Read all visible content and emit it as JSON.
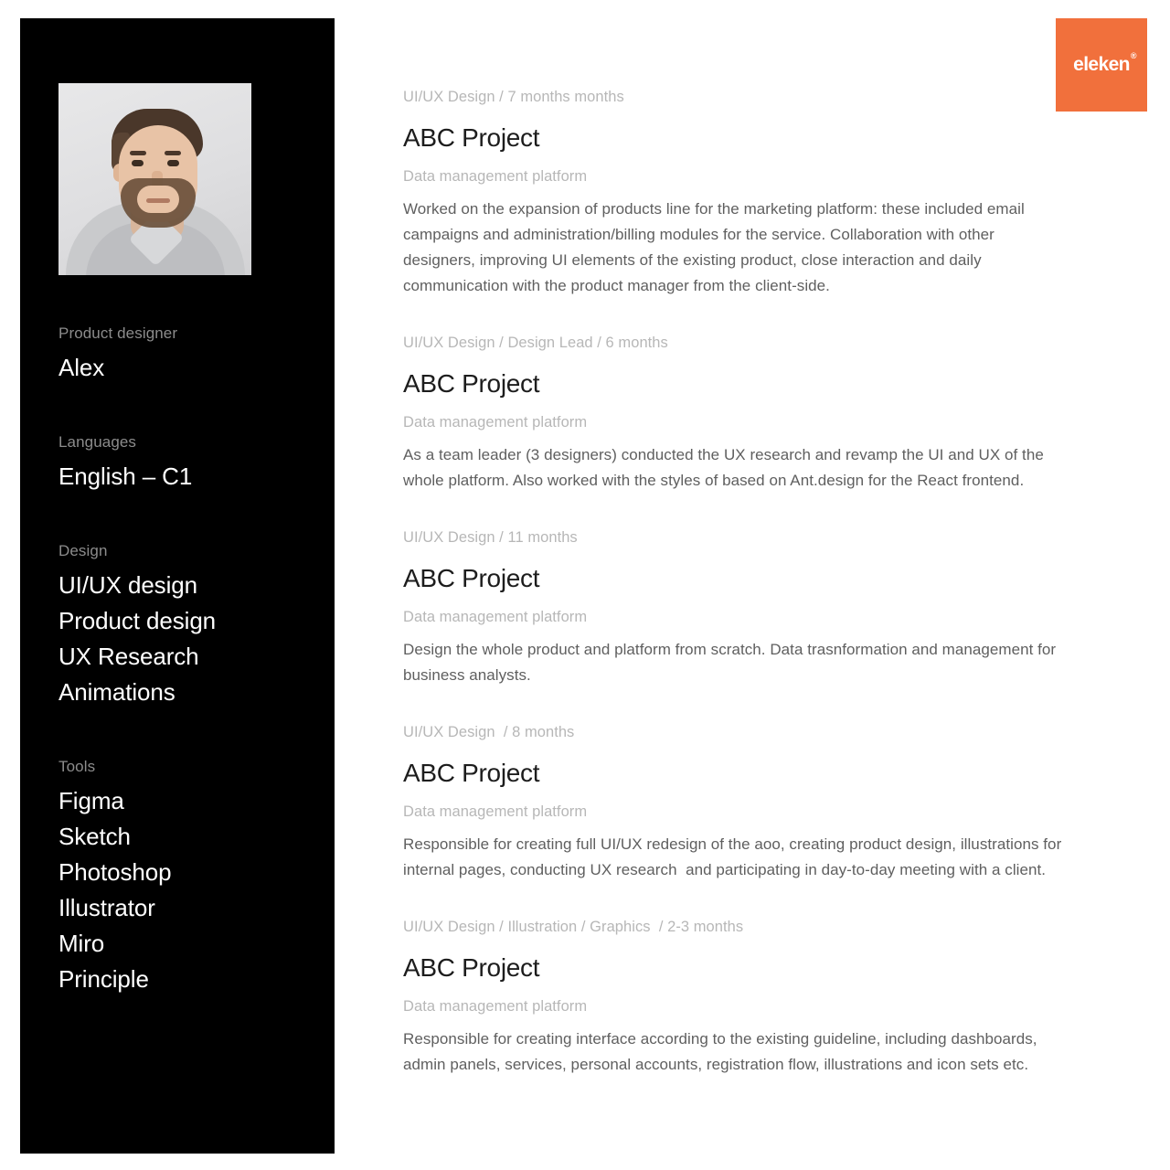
{
  "logo": {
    "text": "eleken",
    "trademark": "®",
    "color": "#f1703c"
  },
  "sidebar": {
    "background": "#000000",
    "avatar_alt": "portrait-photo",
    "groups": [
      {
        "label": "Product designer",
        "value": "Alex"
      },
      {
        "label": "Languages",
        "value": "English – C1"
      },
      {
        "label": "Design",
        "items": [
          "UI/UX design",
          "Product design",
          "UX Research",
          "Animations"
        ]
      },
      {
        "label": "Tools",
        "items": [
          "Figma",
          "Sketch",
          "Photoshop",
          "Illustrator",
          "Miro",
          "Principle"
        ]
      }
    ]
  },
  "main": {
    "entries": [
      {
        "meta": "UI/UX Design / 7 months months",
        "title": "ABC Project",
        "subtitle": "Data management platform",
        "description": "Worked on the expansion of products line for the marketing platform: these included email campaigns and administration/billing modules for the service. Collaboration with other designers, improving UI elements of the existing product, close interaction and daily communication with the product manager from the client-side."
      },
      {
        "meta": "UI/UX Design / Design Lead / 6 months",
        "title": "ABC Project",
        "subtitle": "Data management platform",
        "description": "As a team leader (3 designers) conducted the UX research and revamp the UI and UX of the whole platform. Also worked with the styles of based on Ant.design for the React frontend."
      },
      {
        "meta": "UI/UX Design / 11 months",
        "title": "ABC Project",
        "subtitle": "Data management platform",
        "description": "Design the whole product and platform from scratch. Data trasnformation and management for business analysts."
      },
      {
        "meta": "UI/UX Design  / 8 months",
        "title": "ABC Project",
        "subtitle": "Data management platform",
        "description": "Responsible for creating full UI/UX redesign of the aoo, creating product design, illustrations for internal pages, conducting UX research  and participating in day-to-day meeting with a client."
      },
      {
        "meta": "UI/UX Design / Illustration / Graphics  / 2-3 months",
        "title": "ABC Project",
        "subtitle": "Data management platform",
        "description": "Responsible for creating interface according to the existing guideline, including dashboards, admin panels, services, personal accounts, registration flow, illustrations and icon sets etc."
      }
    ]
  }
}
